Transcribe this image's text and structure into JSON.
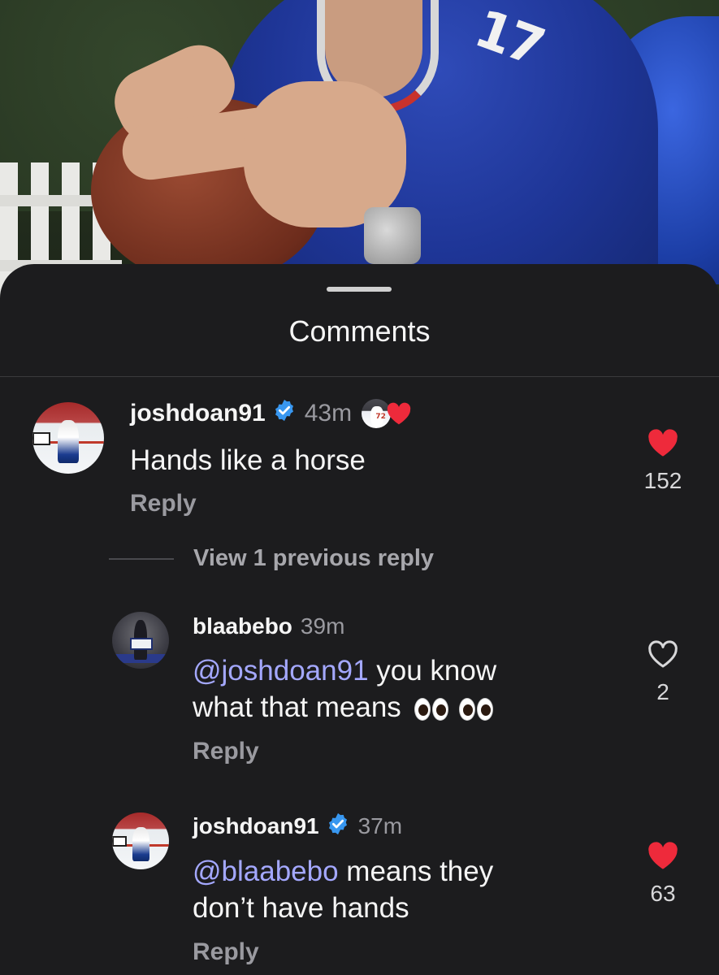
{
  "sheet": {
    "title": "Comments"
  },
  "background_photo": {
    "jersey_number": "17"
  },
  "comments": [
    {
      "username": "joshdoan91",
      "verified": true,
      "time": "43m",
      "liked_by_author": true,
      "text": "Hands like a horse",
      "reply_label": "Reply",
      "liked": true,
      "likes": "152"
    }
  ],
  "view_replies": {
    "label": "View 1 previous reply"
  },
  "replies": [
    {
      "username": "blaabebo",
      "verified": false,
      "time": "39m",
      "mention": "@joshdoan91",
      "text_part1": " you know",
      "text_part2": "what that means",
      "reply_label": "Reply",
      "liked": false,
      "likes": "2"
    },
    {
      "username": "joshdoan91",
      "verified": true,
      "time": "37m",
      "mention": "@blaabebo",
      "text_part1": " means they",
      "text_part2": "don’t have hands",
      "reply_label": "Reply",
      "liked": true,
      "likes": "63"
    }
  ],
  "colors": {
    "heart": "#ee2a3b",
    "verified": "#3897f0",
    "mention": "#a4a8ff",
    "background": "#1c1c1e"
  }
}
